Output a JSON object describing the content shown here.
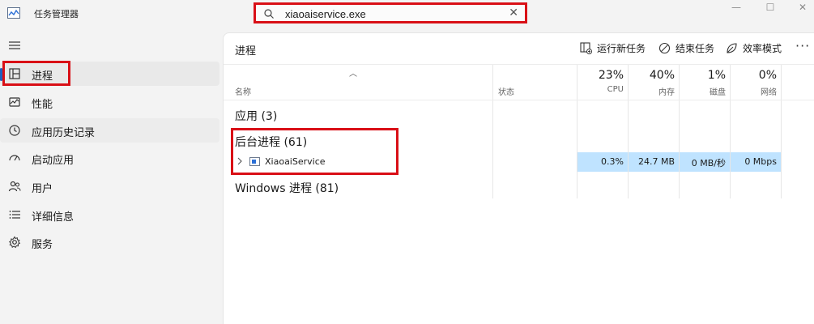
{
  "window": {
    "title": "任务管理器",
    "minimize": "—",
    "maximize": "☐",
    "close": "✕"
  },
  "search": {
    "value": "xiaoaiservice.exe",
    "clear": "✕"
  },
  "sidebar": {
    "items": [
      {
        "label": "进程"
      },
      {
        "label": "性能"
      },
      {
        "label": "应用历史记录"
      },
      {
        "label": "启动应用"
      },
      {
        "label": "用户"
      },
      {
        "label": "详细信息"
      },
      {
        "label": "服务"
      }
    ]
  },
  "main": {
    "title": "进程",
    "toolbar": {
      "run_new_task": "运行新任务",
      "end_task": "结束任务",
      "efficiency_mode": "效率模式",
      "more": "···"
    },
    "columns": {
      "name": "名称",
      "status": "状态",
      "cpu_pct": "23%",
      "cpu": "CPU",
      "mem_pct": "40%",
      "mem": "内存",
      "disk_pct": "1%",
      "disk": "磁盘",
      "net_pct": "0%",
      "net": "网络"
    },
    "groups": {
      "apps": "应用 (3)",
      "background": "后台进程 (61)",
      "windows": "Windows 进程 (81)"
    },
    "process": {
      "name": "XiaoaiService",
      "cpu": "0.3%",
      "memory": "24.7 MB",
      "disk": "0 MB/秒",
      "network": "0 Mbps"
    }
  },
  "colors": {
    "highlight_red": "#d90f16",
    "row_highlight": "#bfe3ff",
    "accent": "#1f5fbf"
  }
}
